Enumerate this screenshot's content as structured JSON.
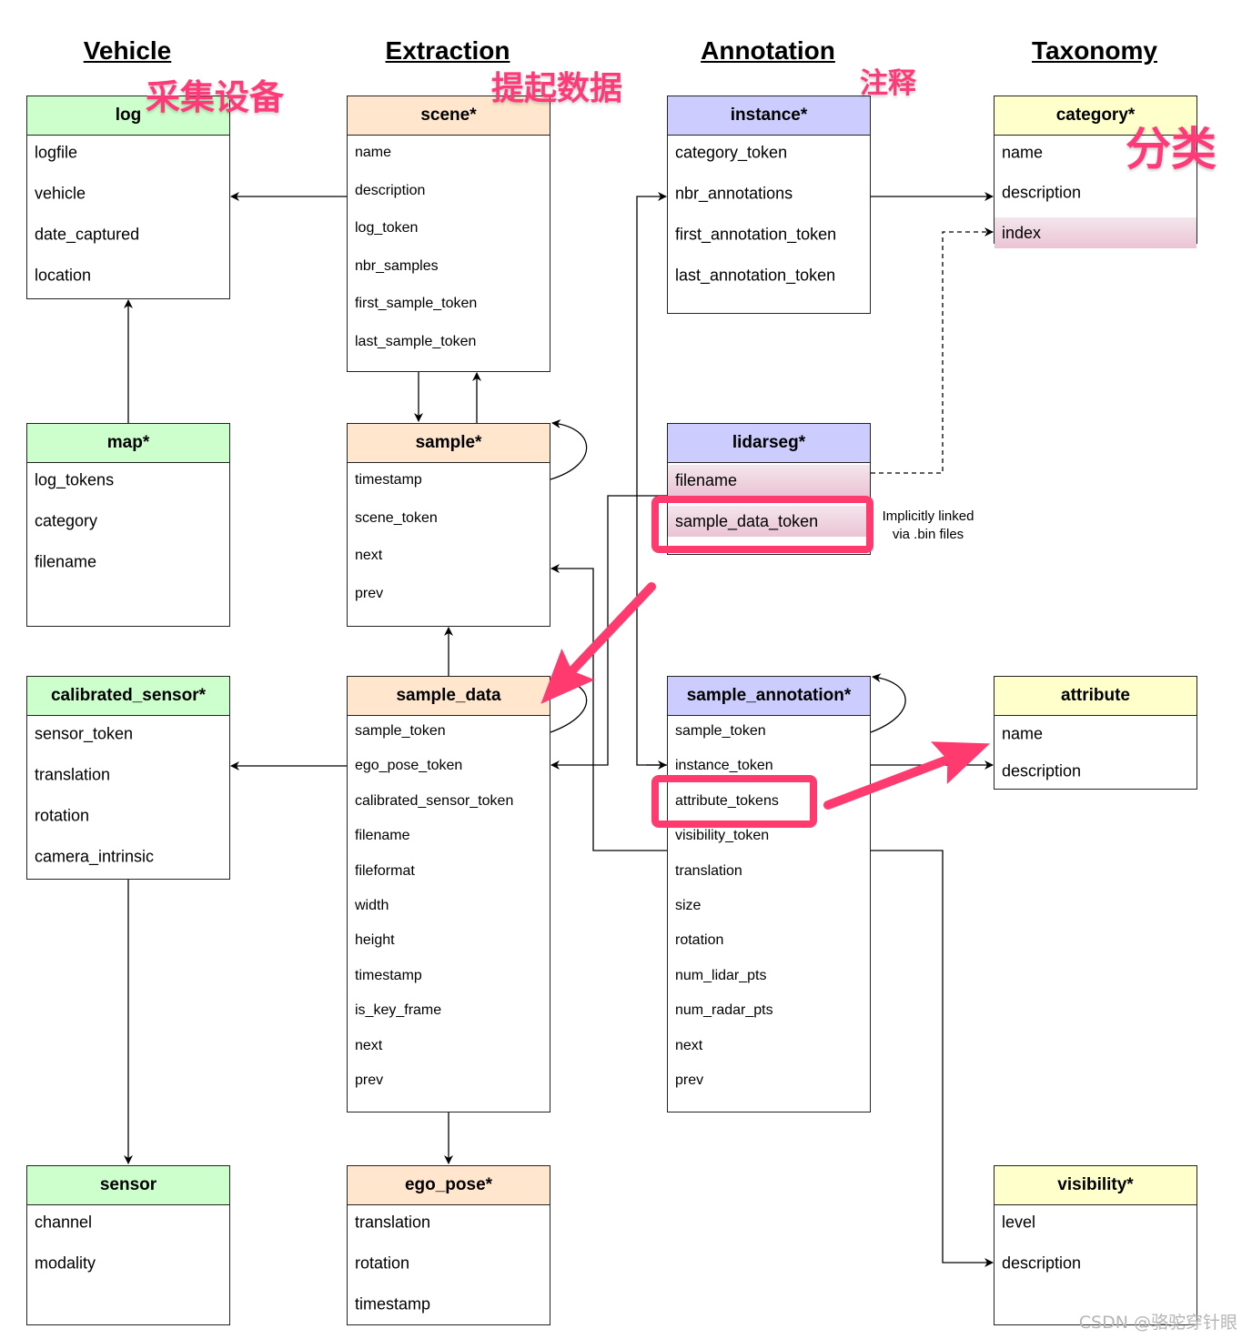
{
  "columns": [
    "Vehicle",
    "Extraction",
    "Annotation",
    "Taxonomy"
  ],
  "cn_labels": [
    "采集设备",
    "提起数据",
    "注释",
    "分类"
  ],
  "entities": [
    {
      "id": "log",
      "title": "log",
      "group": "vehicle",
      "fields": [
        "logfile",
        "vehicle",
        "date_captured",
        "location"
      ]
    },
    {
      "id": "scene",
      "title": "scene*",
      "group": "extraction",
      "fields": [
        "name",
        "description",
        "log_token",
        "nbr_samples",
        "first_sample_token",
        "last_sample_token"
      ]
    },
    {
      "id": "instance",
      "title": "instance*",
      "group": "annotation",
      "fields": [
        "category_token",
        "nbr_annotations",
        "first_annotation_token",
        "last_annotation_token"
      ]
    },
    {
      "id": "category",
      "title": "category*",
      "group": "taxonomy",
      "fields": [
        "name",
        "description",
        "index"
      ],
      "highlighted": [
        "index"
      ]
    },
    {
      "id": "map",
      "title": "map*",
      "group": "vehicle",
      "fields": [
        "log_tokens",
        "category",
        "filename"
      ]
    },
    {
      "id": "sample",
      "title": "sample*",
      "group": "extraction",
      "fields": [
        "timestamp",
        "scene_token",
        "next",
        "prev"
      ]
    },
    {
      "id": "lidarseg",
      "title": "lidarseg*",
      "group": "annotation",
      "fields": [
        "filename",
        "sample_data_token"
      ],
      "highlighted": [
        "filename",
        "sample_data_token"
      ]
    },
    {
      "id": "calibrated_sensor",
      "title": "calibrated_sensor*",
      "group": "vehicle",
      "fields": [
        "sensor_token",
        "translation",
        "rotation",
        "camera_intrinsic"
      ]
    },
    {
      "id": "sample_data",
      "title": "sample_data",
      "group": "extraction",
      "fields": [
        "sample_token",
        "ego_pose_token",
        "calibrated_sensor_token",
        "filename",
        "fileformat",
        "width",
        "height",
        "timestamp",
        "is_key_frame",
        "next",
        "prev"
      ]
    },
    {
      "id": "sample_annotation",
      "title": "sample_annotation*",
      "group": "annotation",
      "fields": [
        "sample_token",
        "instance_token",
        "attribute_tokens",
        "visibility_token",
        "translation",
        "size",
        "rotation",
        "num_lidar_pts",
        "num_radar_pts",
        "next",
        "prev"
      ]
    },
    {
      "id": "attribute",
      "title": "attribute",
      "group": "taxonomy",
      "fields": [
        "name",
        "description"
      ]
    },
    {
      "id": "sensor",
      "title": "sensor",
      "group": "vehicle",
      "fields": [
        "channel",
        "modality"
      ]
    },
    {
      "id": "ego_pose",
      "title": "ego_pose*",
      "group": "extraction",
      "fields": [
        "translation",
        "rotation",
        "timestamp"
      ]
    },
    {
      "id": "visibility",
      "title": "visibility*",
      "group": "taxonomy",
      "fields": [
        "level",
        "description"
      ]
    }
  ],
  "note": {
    "line1": "Implicitly linked",
    "line2": "via .bin files"
  },
  "watermark": "CSDN @骆驼穿针眼",
  "colors": {
    "vehicle": "#ccffcc",
    "extraction": "#ffe6cc",
    "annotation": "#ccccff",
    "taxonomy": "#ffffcc",
    "highlight": "#ff3a6e"
  }
}
